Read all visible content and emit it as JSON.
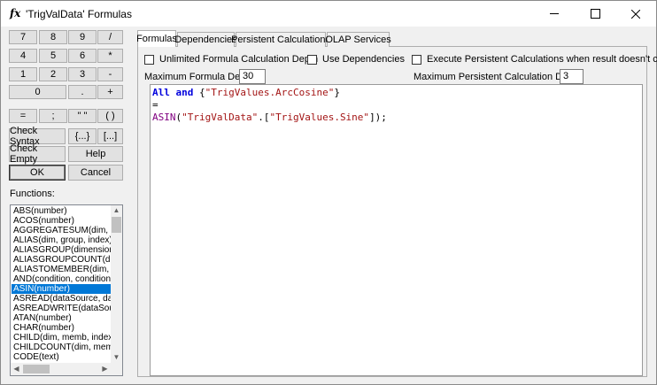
{
  "window": {
    "title": "'TrigValData' Formulas",
    "icon": "fx"
  },
  "keypad": [
    [
      "7",
      "8",
      "9",
      "/"
    ],
    [
      "4",
      "5",
      "6",
      "*"
    ],
    [
      "1",
      "2",
      "3",
      "-"
    ],
    [
      "0",
      ".",
      "+"
    ],
    [
      "=",
      ";",
      "\" \"",
      "( )"
    ]
  ],
  "buttons": {
    "check_syntax": "Check Syntax",
    "braces": "{...}",
    "brackets": "[...]",
    "check_empty": "Check Empty",
    "help": "Help",
    "ok": "OK",
    "cancel": "Cancel"
  },
  "functions": {
    "label": "Functions:",
    "items": [
      "ABS(number)",
      "ACOS(number)",
      "AGGREGATESUM(dim, me",
      "ALIAS(dim, group, index)",
      "ALIASGROUP(dimension, i",
      "ALIASGROUPCOUNT(dime",
      "ALIASTOMEMBER(dim, gro",
      "AND(condition, condition, ...",
      "ASIN(number)",
      "ASREAD(dataSource, data",
      "ASREADWRITE(dataSourc",
      "ATAN(number)",
      "CHAR(number)",
      "CHILD(dim, memb, index)",
      "CHILDCOUNT(dim, memb)",
      "CODE(text)"
    ],
    "selected": "ASIN(number)"
  },
  "tabs": [
    "Formulas",
    "Dependencies",
    "Persistent Calculations",
    "OLAP Services"
  ],
  "options": {
    "unlimited_depth": "Unlimited Formula Calculation Depth",
    "use_dependencies": "Use Dependencies",
    "execute_persistent": "Execute Persistent Calculations when result doesn't change",
    "max_formula_depth_label": "Maximum Formula Depth:",
    "max_formula_depth": "30",
    "max_persistent_depth_label": "Maximum Persistent Calculation Depth:",
    "max_persistent_depth": "3"
  },
  "code": {
    "l1_kw1": "All",
    "l1_kw2": "and",
    "l1_open": " {",
    "l1_str": "\"TrigValues.ArcCosine\"",
    "l1_close": "}",
    "l2": "=",
    "l3_fn": "ASIN",
    "l3_open": "(",
    "l3_str1": "\"TrigValData\"",
    "l3_dot": ".[",
    "l3_str2": "\"TrigValues.Sine\"",
    "l3_close": "]);"
  }
}
